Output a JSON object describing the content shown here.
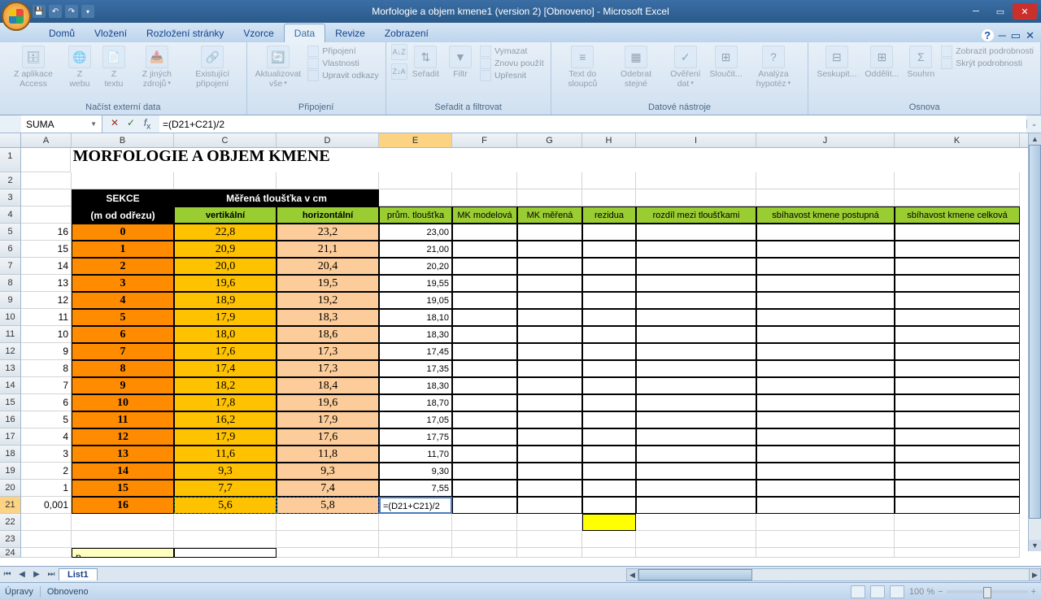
{
  "window": {
    "title": "Morfologie a objem kmene1 (version 2) [Obnoveno] - Microsoft Excel"
  },
  "menu": {
    "tabs": [
      "Domů",
      "Vložení",
      "Rozložení stránky",
      "Vzorce",
      "Data",
      "Revize",
      "Zobrazení"
    ],
    "active_index": 4
  },
  "ribbon": {
    "groups": [
      {
        "label": "Načíst externí data",
        "items": [
          "Z aplikace Access",
          "Z webu",
          "Z textu",
          "Z jiných zdrojů",
          "Existující připojení"
        ],
        "disabled": true
      },
      {
        "label": "Připojení",
        "items": [
          "Aktualizovat vše"
        ],
        "sub": [
          "Připojení",
          "Vlastnosti",
          "Upravit odkazy"
        ],
        "disabled": true
      },
      {
        "label": "Seřadit a filtrovat",
        "items": [
          "A↓Z",
          "Z↓A",
          "Seřadit",
          "Filtr"
        ],
        "sub": [
          "Vymazat",
          "Znovu použít",
          "Upřesnit"
        ],
        "disabled": true
      },
      {
        "label": "Datové nástroje",
        "items": [
          "Text do sloupců",
          "Odebrat stejné",
          "Ověření dat",
          "Sloučit...",
          "Analýza hypotéz"
        ],
        "disabled": true
      },
      {
        "label": "Osnova",
        "items": [
          "Seskupit...",
          "Oddělit...",
          "Souhrn"
        ],
        "sub": [
          "Zobrazit podrobnosti",
          "Skrýt podrobnosti"
        ],
        "disabled": true
      }
    ]
  },
  "formula_bar": {
    "name_box": "SUMA",
    "formula": "=(D21+C21)/2"
  },
  "columns": [
    "A",
    "B",
    "C",
    "D",
    "E",
    "F",
    "G",
    "H",
    "I",
    "J",
    "K"
  ],
  "active_column": "E",
  "active_row": 21,
  "sheet": {
    "title": "MORFOLOGIE A OBJEM KMENE",
    "hdr_sekce1": "SEKCE",
    "hdr_sekce2": "(m od odřezu)",
    "hdr_merena": "Měřená tloušťka v cm",
    "hdr_vert": "vertikální",
    "hdr_horiz": "horizontální",
    "hdr_E": "prům. tloušťka",
    "hdr_F": "MK modelová",
    "hdr_G": "MK měřená",
    "hdr_H": "rezidua",
    "hdr_I": "rozdíl mezi tloušťkami",
    "hdr_J": "sbíhavost kmene postupná",
    "hdr_K": "sbíhavost kmene celková",
    "cell_E21": "=(D21+C21)/2",
    "cell_B24": "p"
  },
  "chart_data": {
    "type": "table",
    "columns_A": [
      16,
      15,
      14,
      13,
      12,
      11,
      10,
      9,
      8,
      7,
      6,
      5,
      4,
      3,
      2,
      1,
      "0,001"
    ],
    "columns_B_sekce": [
      0,
      1,
      2,
      3,
      4,
      5,
      6,
      7,
      8,
      9,
      10,
      11,
      12,
      13,
      14,
      15,
      16
    ],
    "columns_C_vert": [
      "22,8",
      "20,9",
      "20,0",
      "19,6",
      "18,9",
      "17,9",
      "18,0",
      "17,6",
      "17,4",
      "18,2",
      "17,8",
      "16,2",
      "17,9",
      "11,6",
      "9,3",
      "7,7",
      "5,6"
    ],
    "columns_D_horiz": [
      "23,2",
      "21,1",
      "20,4",
      "19,5",
      "19,2",
      "18,3",
      "18,6",
      "17,3",
      "17,3",
      "18,4",
      "19,6",
      "17,9",
      "17,6",
      "11,8",
      "9,3",
      "7,4",
      "5,8"
    ],
    "columns_E_avg": [
      "23,00",
      "21,00",
      "20,20",
      "19,55",
      "19,05",
      "18,10",
      "18,30",
      "17,45",
      "17,35",
      "18,30",
      "18,70",
      "17,05",
      "17,75",
      "11,70",
      "9,30",
      "7,55",
      ""
    ]
  },
  "sheet_tabs": {
    "active": "List1"
  },
  "status": {
    "mode": "Úpravy",
    "extra": "Obnoveno",
    "zoom": "100 %"
  }
}
